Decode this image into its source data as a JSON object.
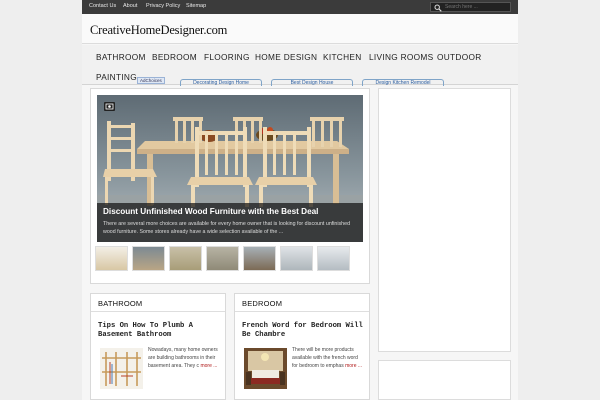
{
  "topbar": {
    "links": [
      "Contact Us",
      "About",
      "Privacy Policy",
      "Sitemap"
    ],
    "search_placeholder": "Search here ..."
  },
  "header": {
    "logo_text": "CreativeHomeDesigner.com"
  },
  "nav": {
    "items": [
      "BATHROOM",
      "BEDROOM",
      "FLOORING",
      "HOME DESIGN",
      "KITCHEN",
      "LIVING ROOMS",
      "OUTDOOR",
      "PAINTING"
    ]
  },
  "ads": {
    "adchoices_label": "AdChoices",
    "links": [
      "Decorating Design Home",
      "Best Design House",
      "Design Kitchen Remodel"
    ]
  },
  "featured": {
    "title": "Discount Unfinished Wood Furniture with the Best Deal",
    "excerpt": "There are several more choices are available for every home owner that is looking for discount unfinished wood furniture. Some stores already have a wide selection available of the ...",
    "thumb_count": 7
  },
  "categories": [
    {
      "label": "BATHROOM",
      "post_title": "Tips On How To Plumb A Basement Bathroom",
      "excerpt": "Nowadays, many home owners are building bathrooms in their basement area. They c",
      "more": "more ..."
    },
    {
      "label": "BEDROOM",
      "post_title": "French Word for Bedroom Will Be Chambre",
      "excerpt": "There will be more products available with the french word for bedroom to emphas",
      "more": "more ..."
    }
  ],
  "colors": {
    "topbar_bg": "#3b3b3b",
    "page_bg": "#eeeeee",
    "more_link": "#b01818",
    "ad_link": "#2a5da0"
  }
}
